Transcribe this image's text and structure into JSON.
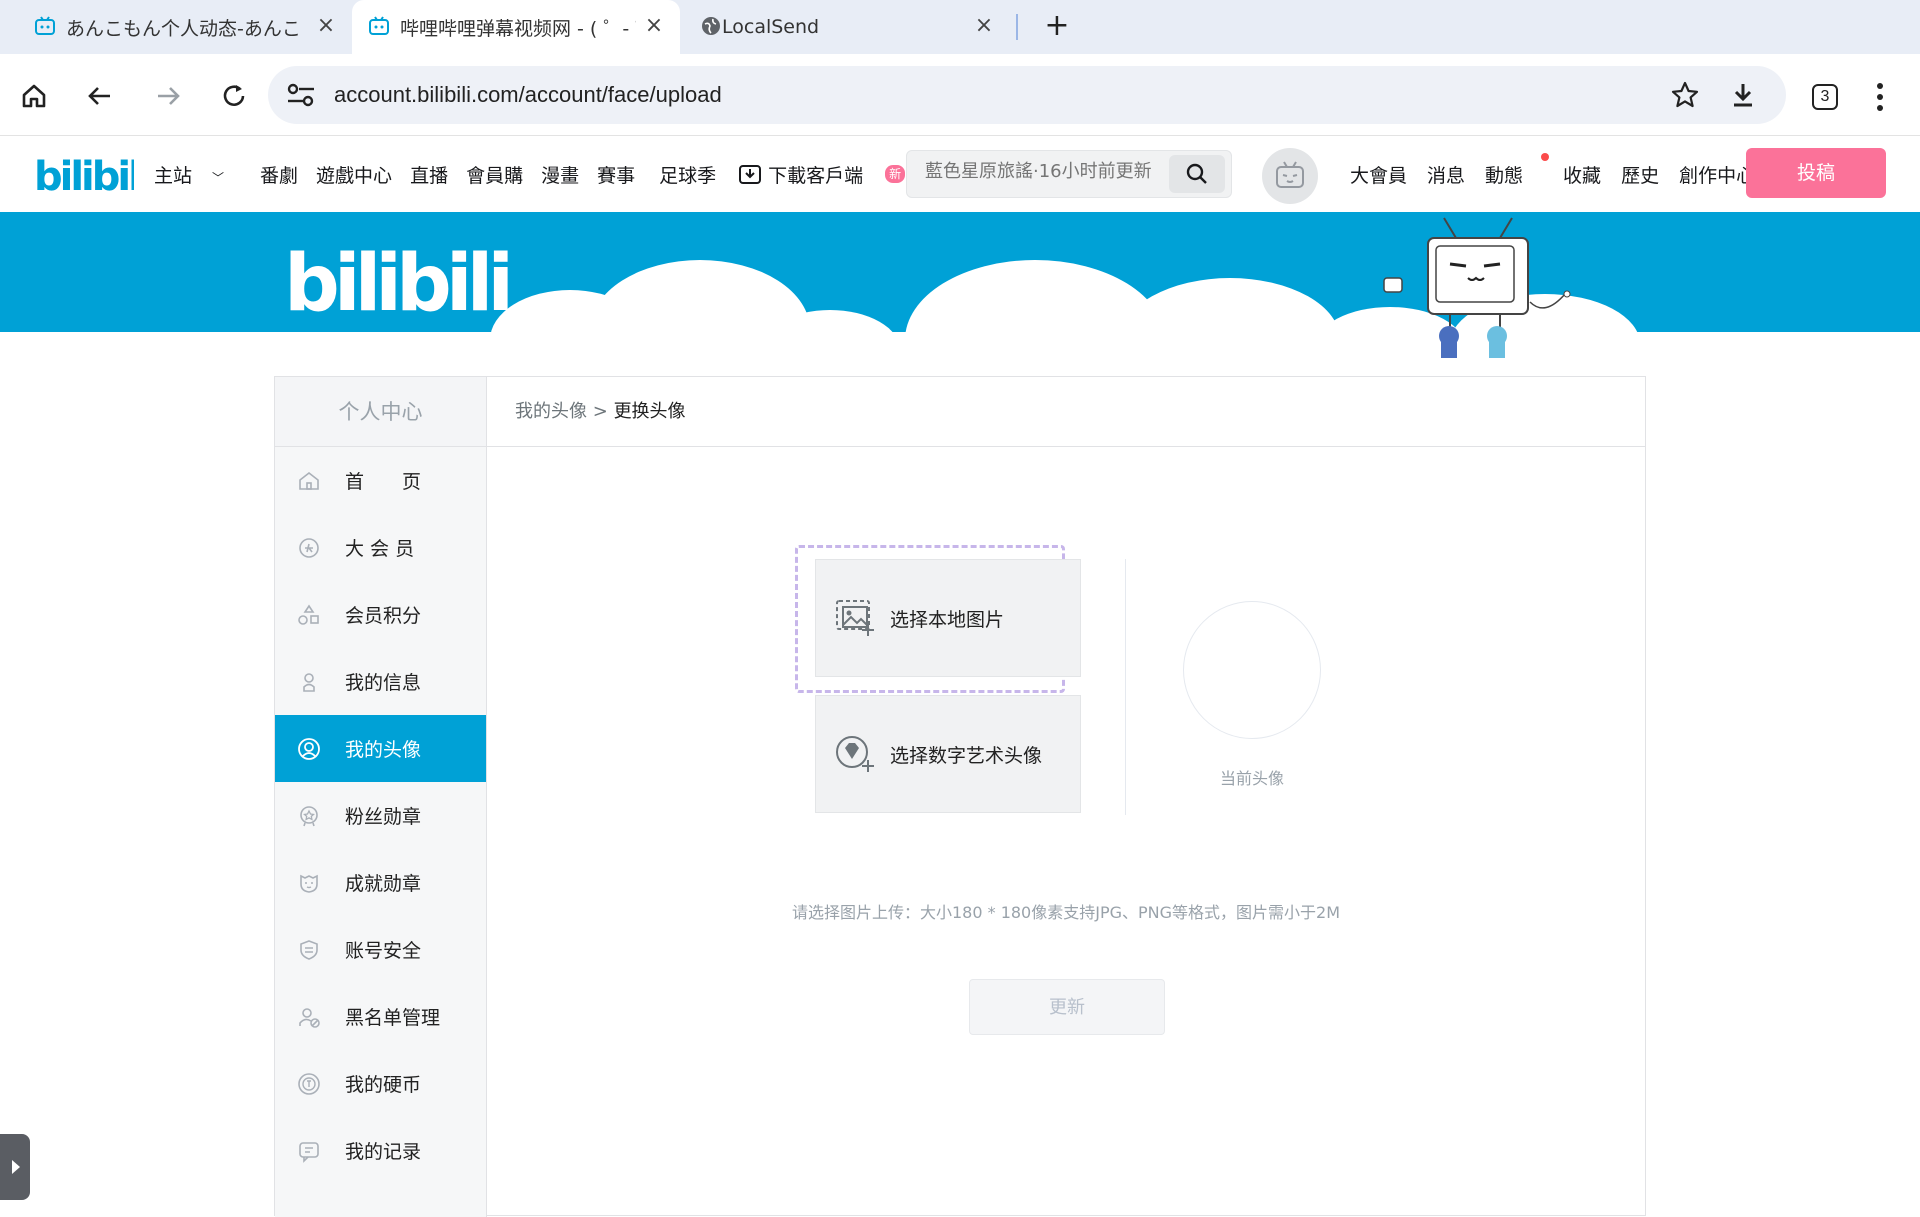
{
  "browser": {
    "tabs": [
      {
        "title": "あんこもん个人动态-あんこも",
        "active": false
      },
      {
        "title": "哔哩哔哩弹幕视频网 - ( ゜- ゜",
        "active": true
      },
      {
        "title": "LocalSend",
        "active": false
      }
    ],
    "url": "account.bilibili.com/account/face/upload",
    "extension_count": "3"
  },
  "header": {
    "nav": [
      "主站",
      "番劇",
      "遊戲中心",
      "直播",
      "會員購",
      "漫畫",
      "賽事",
      "足球季"
    ],
    "download_label": "下載客戶端",
    "new_badge": "新",
    "search_placeholder": "藍色星原旅謠·16小时前更新",
    "right": [
      "大會員",
      "消息",
      "動態",
      "收藏",
      "歷史",
      "創作中心"
    ],
    "upload_label": "投稿"
  },
  "sidebar": {
    "title": "个人中心",
    "items": [
      {
        "label": "首　　页",
        "icon": "home-icon"
      },
      {
        "label": "大 会 员",
        "icon": "vip-icon"
      },
      {
        "label": "会员积分",
        "icon": "points-icon"
      },
      {
        "label": "我的信息",
        "icon": "user-icon"
      },
      {
        "label": "我的头像",
        "icon": "avatar-icon",
        "active": true
      },
      {
        "label": "粉丝勋章",
        "icon": "fan-medal-icon"
      },
      {
        "label": "成就勋章",
        "icon": "achievement-icon"
      },
      {
        "label": "账号安全",
        "icon": "shield-icon"
      },
      {
        "label": "黑名单管理",
        "icon": "blacklist-icon"
      },
      {
        "label": "我的硬币",
        "icon": "coin-icon"
      },
      {
        "label": "我的记录",
        "icon": "record-icon"
      }
    ]
  },
  "breadcrumb": {
    "parent": "我的头像",
    "sep": ">",
    "current": "更换头像"
  },
  "upload": {
    "local_label": "选择本地图片",
    "nft_label": "选择数字艺术头像",
    "current_label": "当前头像",
    "hint": "请选择图片上传：大小180 * 180像素支持JPG、PNG等格式，图片需小于2M",
    "update_label": "更新"
  },
  "colors": {
    "accent": "#00a1d6",
    "pink": "#fb7299",
    "banner": "#00a1d6"
  }
}
